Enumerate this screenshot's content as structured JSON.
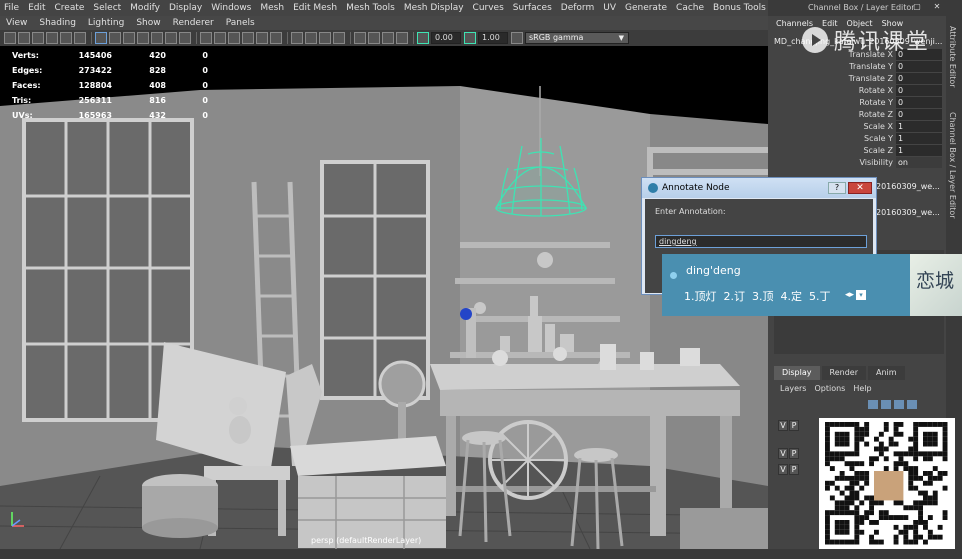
{
  "menubar": [
    "File",
    "Edit",
    "Create",
    "Select",
    "Modify",
    "Display",
    "Windows",
    "Mesh",
    "Edit Mesh",
    "Mesh Tools",
    "Mesh Display",
    "Curves",
    "Surfaces",
    "Deform",
    "UV",
    "Generate",
    "Cache",
    "Bonus Tools",
    "Help"
  ],
  "panel_menu": [
    "View",
    "Shading",
    "Lighting",
    "Show",
    "Renderer",
    "Panels"
  ],
  "toolbar": {
    "value_a": "0.00",
    "value_b": "1.00",
    "colorspace": "sRGB gamma"
  },
  "hud": {
    "rows": [
      {
        "label": "Verts:",
        "a": "145406",
        "b": "420",
        "c": "0"
      },
      {
        "label": "Edges:",
        "a": "273422",
        "b": "828",
        "c": "0"
      },
      {
        "label": "Faces:",
        "a": "128804",
        "b": "408",
        "c": "0"
      },
      {
        "label": "Tris:",
        "a": "256311",
        "b": "816",
        "c": "0"
      },
      {
        "label": "UVs:",
        "a": "165963",
        "b": "432",
        "c": "0"
      }
    ]
  },
  "viewport": {
    "camera_label": "persp (defaultRenderLayer)"
  },
  "channel_box": {
    "window_title": "Channel Box / Layer Editor",
    "menu": [
      "Channels",
      "Edit",
      "Object",
      "Show"
    ],
    "object_name": "MD_changjing_kafeiwu_20160309_wenji...",
    "attributes": [
      {
        "label": "Translate X",
        "value": "0"
      },
      {
        "label": "Translate Y",
        "value": "0"
      },
      {
        "label": "Translate Z",
        "value": "0"
      },
      {
        "label": "Rotate X",
        "value": "0"
      },
      {
        "label": "Rotate Y",
        "value": "0"
      },
      {
        "label": "Rotate Z",
        "value": "0"
      },
      {
        "label": "Scale X",
        "value": "1"
      },
      {
        "label": "Scale Y",
        "value": "1"
      },
      {
        "label": "Scale Z",
        "value": "1"
      },
      {
        "label": "Visibility",
        "value": "on"
      }
    ],
    "shape_rows": [
      "20160309_we...",
      "20160309_we..."
    ],
    "layer_tabs": [
      "Display",
      "Render",
      "Anim"
    ],
    "layer_menu": [
      "Layers",
      "Options",
      "Help"
    ]
  },
  "side_tabs": [
    "Attribute Editor",
    "Channel Box / Layer Editor"
  ],
  "watermark": {
    "logo_text": "腾讯课堂"
  },
  "annotate_dialog": {
    "title": "Annotate Node",
    "help": "?",
    "close": "✕",
    "prompt": "Enter Annotation:",
    "input_value": "dingdeng"
  },
  "ime": {
    "composition": "ding'deng",
    "candidates": [
      "1.顶灯",
      "2.订",
      "3.顶",
      "4.定",
      "5.丁"
    ],
    "ad_text": "恋城"
  },
  "colors": {
    "wireframe_highlight": "#3fe3b3",
    "ime_bg": "#4a8fb0"
  },
  "icons": [
    "play-logo-icon",
    "help-icon",
    "close-icon",
    "axis-icon",
    "qr-code-icon"
  ]
}
